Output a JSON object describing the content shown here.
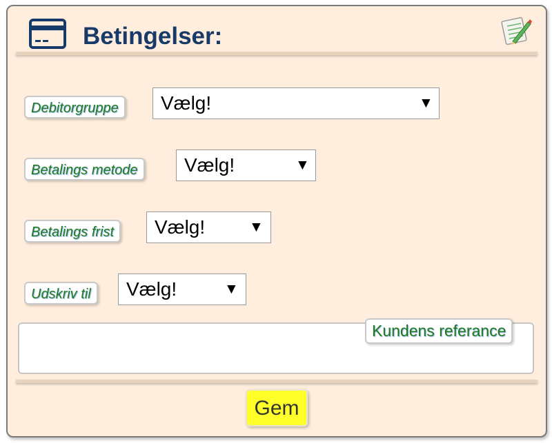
{
  "header": {
    "title": "Betingelser:",
    "icon": "credit-card-icon",
    "edit_icon": "edit-notepad-icon"
  },
  "fields": [
    {
      "label": "Debitorgruppe",
      "value": "Vælg!"
    },
    {
      "label": "Betalings metode",
      "value": "Vælg!"
    },
    {
      "label": "Betalings frist",
      "value": "Vælg!"
    },
    {
      "label": "Udskriv til",
      "value": "Vælg!"
    }
  ],
  "reference": {
    "label": "Kundens referance",
    "value": ""
  },
  "save_button": {
    "label": "Gem"
  },
  "colors": {
    "panel_bg": "#ffeedd",
    "title": "#173a68",
    "label_text": "#1d7a1d",
    "save_button": "#ffff2a"
  }
}
